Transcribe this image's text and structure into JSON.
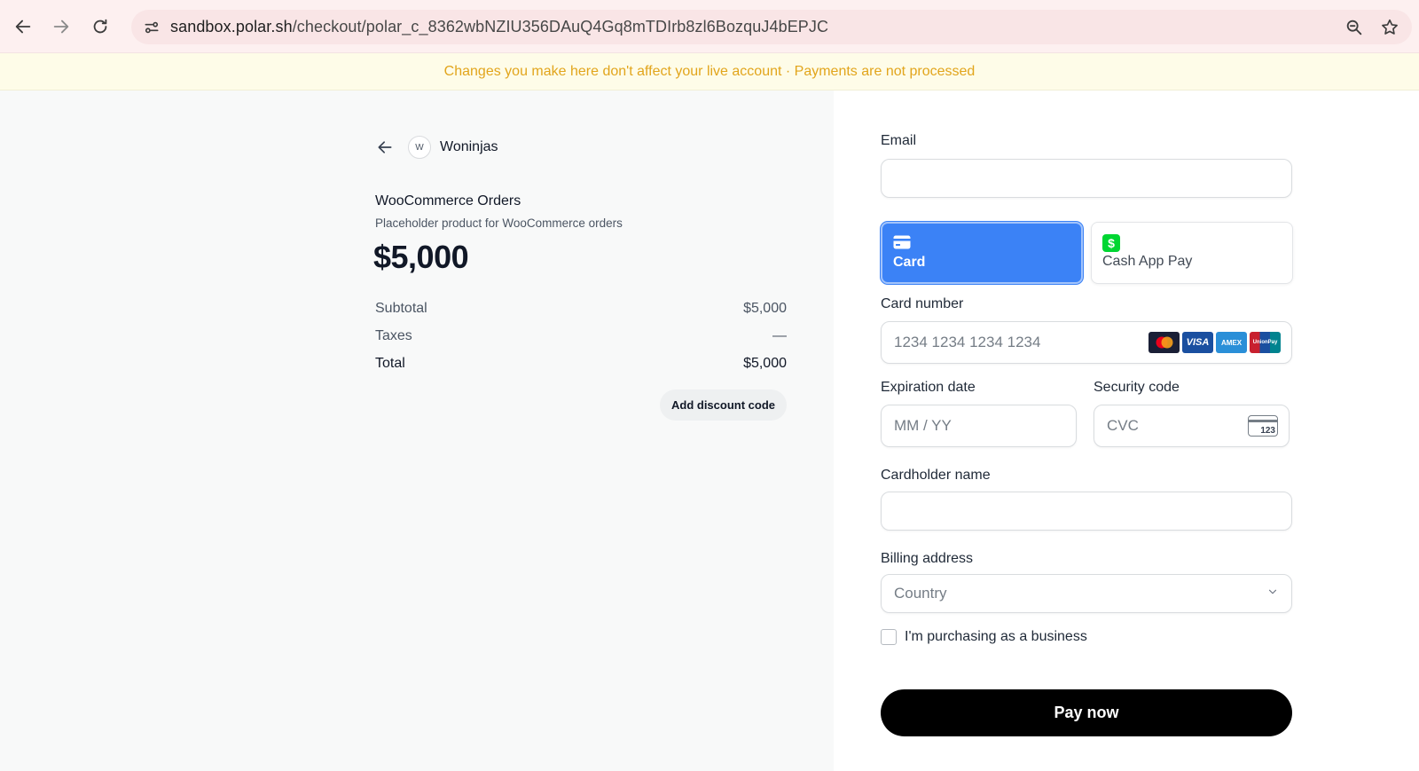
{
  "browser": {
    "url_host": "sandbox.polar.sh",
    "url_path": "/checkout/polar_c_8362wbNZIU356DAuQ4Gq8mTDIrb8zl6BozquJ4bEPJC",
    "icons": [
      "back-arrow-icon",
      "forward-arrow-icon",
      "reload-icon",
      "site-settings-icon",
      "zoom-icon",
      "bookmark-star-icon"
    ]
  },
  "banner": {
    "text": "Changes you make here don't affect your live account · Payments are not processed",
    "color": "#e2a51c"
  },
  "merchant": {
    "avatar_initial": "W",
    "name": "Woninjas"
  },
  "product": {
    "title": "WooCommerce Orders",
    "description": "Placeholder product for WooCommerce orders",
    "price": "$5,000"
  },
  "summary": {
    "subtotal_label": "Subtotal",
    "subtotal_value": "$5,000",
    "taxes_label": "Taxes",
    "taxes_value": "—",
    "total_label": "Total",
    "total_value": "$5,000",
    "discount_button": "Add discount code"
  },
  "form": {
    "email_label": "Email",
    "email_value": "",
    "payment_methods": [
      {
        "label": "Card",
        "icon": "credit-card-icon",
        "selected": true
      },
      {
        "label": "Cash App Pay",
        "icon": "cash-app-icon",
        "selected": false
      }
    ],
    "card_number_label": "Card number",
    "card_number_placeholder": "1234 1234 1234 1234",
    "card_brands": [
      {
        "name": "mastercard",
        "color": "#1a1f36"
      },
      {
        "name": "VISA",
        "color": "#1a4fa0"
      },
      {
        "name": "AMEX",
        "color": "#2a8fd8"
      },
      {
        "name": "UnionPay",
        "color": "#c8202f"
      }
    ],
    "expiration_label": "Expiration date",
    "expiration_placeholder": "MM / YY",
    "security_label": "Security code",
    "security_placeholder": "CVC",
    "cvc_icon_text": "123",
    "cardholder_label": "Cardholder name",
    "cardholder_value": "",
    "billing_label": "Billing address",
    "country_placeholder": "Country",
    "business_checkbox_label": "I'm purchasing as a business",
    "business_checked": false,
    "pay_button": "Pay now"
  },
  "colors": {
    "accent_blue": "#3b82f6",
    "pay_button": "#000000",
    "left_panel_bg": "#f8f9f9"
  }
}
